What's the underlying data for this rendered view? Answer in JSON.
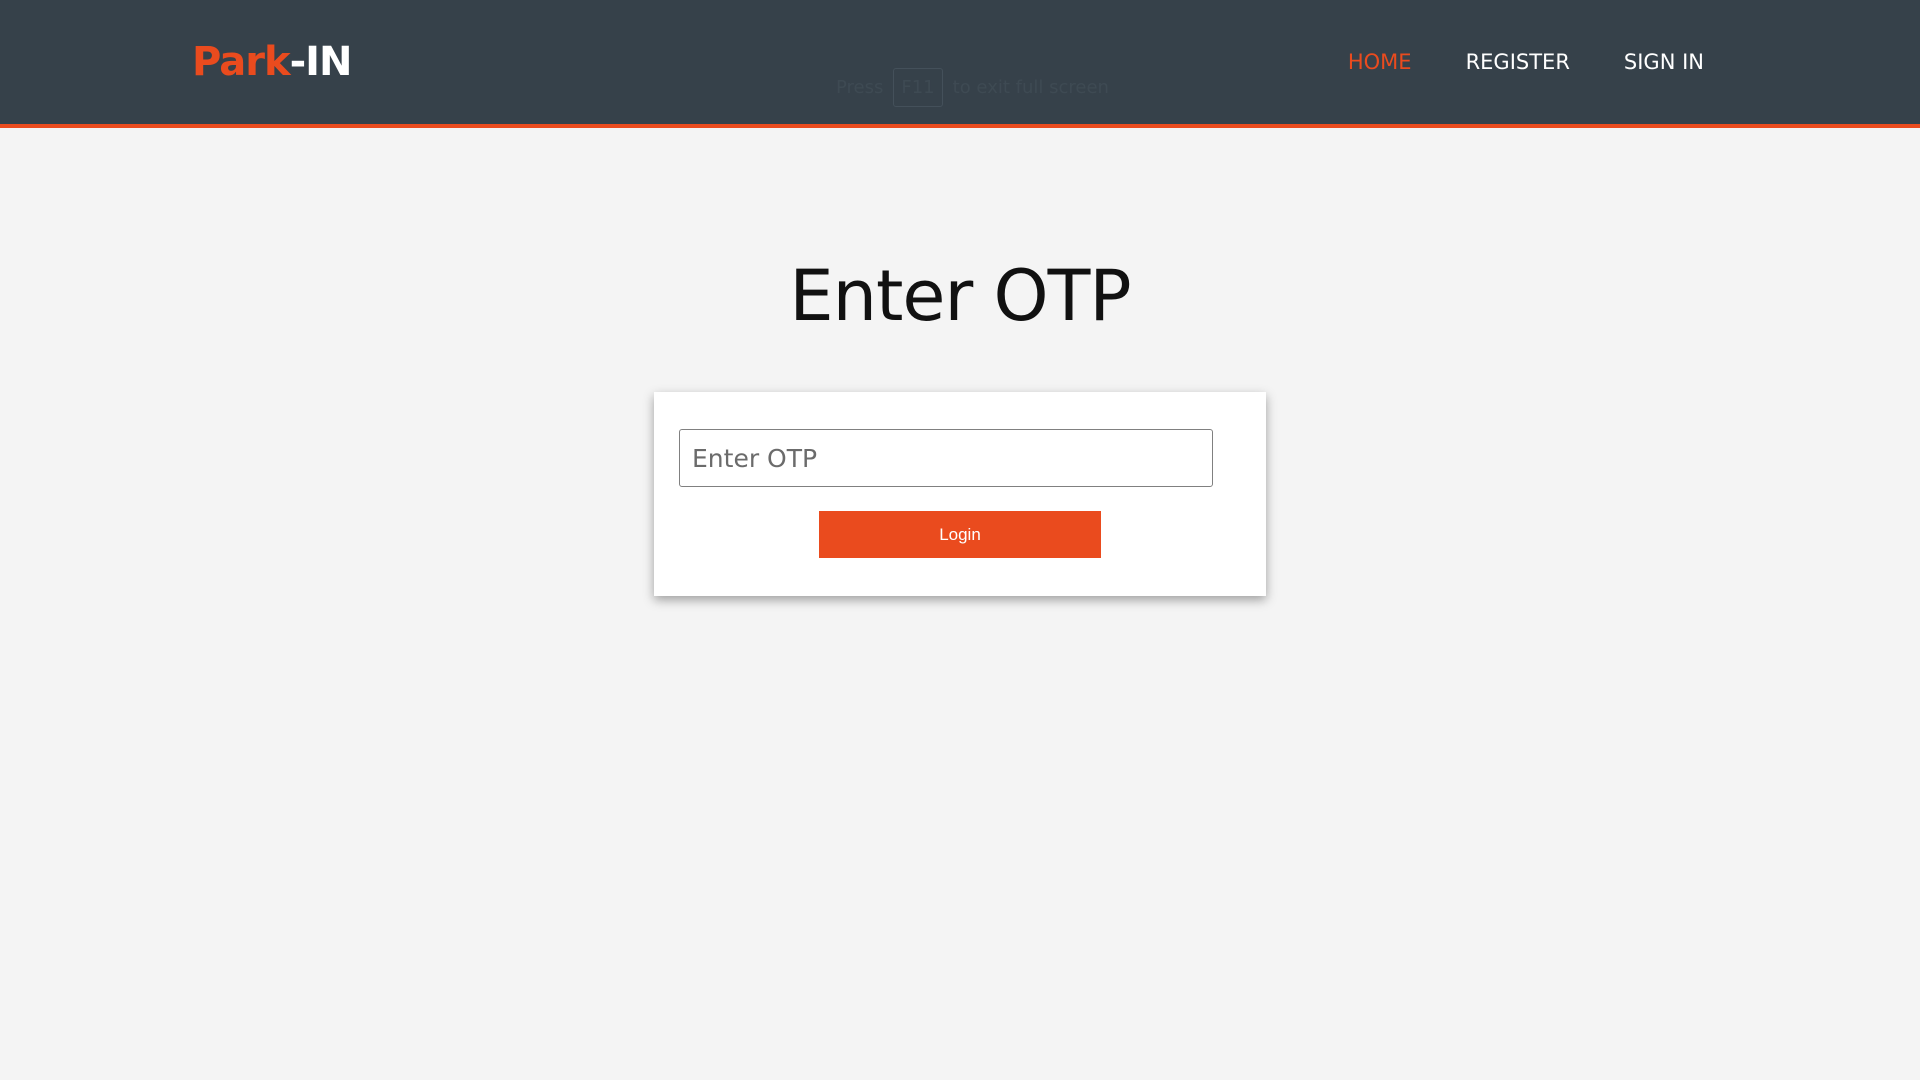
{
  "brand": {
    "logo_part1": "Park",
    "logo_part2": "-IN"
  },
  "fullscreen_hint": {
    "prefix": "Press",
    "key": "F11",
    "suffix": "to exit full screen"
  },
  "nav": {
    "items": [
      {
        "label": "HOME",
        "active": true
      },
      {
        "label": "REGISTER",
        "active": false
      },
      {
        "label": "SIGN IN",
        "active": false
      }
    ]
  },
  "main": {
    "title": "Enter OTP",
    "otp_placeholder": "Enter OTP",
    "otp_value": "",
    "login_label": "Login"
  },
  "colors": {
    "header_bg": "#36414a",
    "accent": "#ea4b1e",
    "page_bg": "#f4f4f4"
  }
}
